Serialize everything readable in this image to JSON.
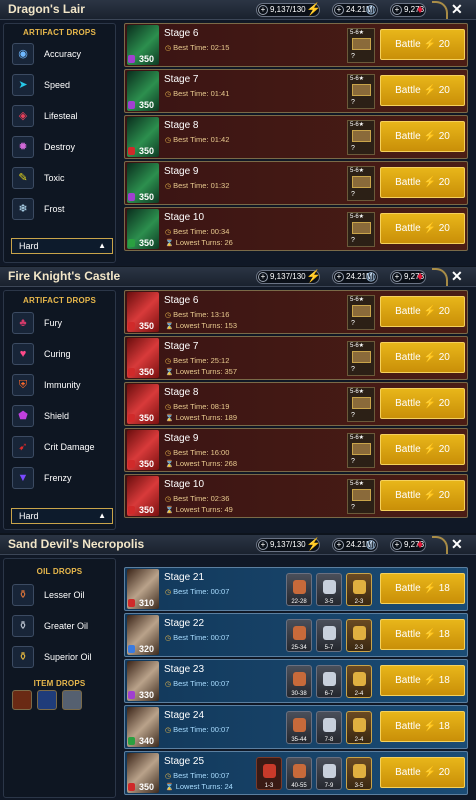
{
  "panels": [
    {
      "title": "Dragon's Lair",
      "resources": {
        "energy": "9,137/130",
        "silver": "24.21M",
        "gems": "9,273"
      },
      "sidebar_heading": "ARTIFACT DROPS",
      "sidebar_items": [
        {
          "label": "Accuracy",
          "icon": "accuracy-icon",
          "glyph": "◉",
          "color": "#6fb8ff"
        },
        {
          "label": "Speed",
          "icon": "speed-icon",
          "glyph": "➤",
          "color": "#27c8e8"
        },
        {
          "label": "Lifesteal",
          "icon": "lifesteal-icon",
          "glyph": "◈",
          "color": "#e8405a"
        },
        {
          "label": "Destroy",
          "icon": "destroy-icon",
          "glyph": "✹",
          "color": "#d06ad8"
        },
        {
          "label": "Toxic",
          "icon": "toxic-icon",
          "glyph": "✎",
          "color": "#e6d81c"
        },
        {
          "label": "Frost",
          "icon": "frost-icon",
          "glyph": "❄",
          "color": "#bfe8ff"
        }
      ],
      "difficulty": "Hard",
      "stages": [
        {
          "stage": "Stage 6",
          "best": "Best Time: 02:15",
          "turns": "",
          "level": "350",
          "reward": "5-6★",
          "reward_q": "?",
          "battle": "Battle",
          "cost": "20"
        },
        {
          "stage": "Stage 7",
          "best": "Best Time: 01:41",
          "turns": "",
          "level": "350",
          "reward": "5-6★",
          "reward_q": "?",
          "battle": "Battle",
          "cost": "20"
        },
        {
          "stage": "Stage 8",
          "best": "Best Time: 01:42",
          "turns": "",
          "level": "350",
          "reward": "5-6★",
          "reward_q": "?",
          "battle": "Battle",
          "cost": "20"
        },
        {
          "stage": "Stage 9",
          "best": "Best Time: 01:32",
          "turns": "",
          "level": "350",
          "reward": "5-6★",
          "reward_q": "?",
          "battle": "Battle",
          "cost": "20"
        },
        {
          "stage": "Stage 10",
          "best": "Best Time: 00:34",
          "turns": "Lowest Turns: 26",
          "level": "350",
          "reward": "5-6★",
          "reward_q": "?",
          "battle": "Battle",
          "cost": "20"
        }
      ]
    },
    {
      "title": "Fire Knight's Castle",
      "resources": {
        "energy": "9,137/130",
        "silver": "24.21M",
        "gems": "9,273"
      },
      "sidebar_heading": "ARTIFACT DROPS",
      "sidebar_items": [
        {
          "label": "Fury",
          "icon": "fury-icon",
          "glyph": "♣",
          "color": "#d23a6a"
        },
        {
          "label": "Curing",
          "icon": "curing-icon",
          "glyph": "♥",
          "color": "#ff4a8a"
        },
        {
          "label": "Immunity",
          "icon": "immunity-icon",
          "glyph": "⛨",
          "color": "#ff6a2a"
        },
        {
          "label": "Shield",
          "icon": "shield-icon",
          "glyph": "⬟",
          "color": "#c040e0"
        },
        {
          "label": "Crit Damage",
          "icon": "crit-damage-icon",
          "glyph": "➹",
          "color": "#e02a2a"
        },
        {
          "label": "Frenzy",
          "icon": "frenzy-icon",
          "glyph": "▼",
          "color": "#7a4aff"
        }
      ],
      "difficulty": "Hard",
      "stages": [
        {
          "stage": "Stage 6",
          "best": "Best Time: 13:16",
          "turns": "Lowest Turns: 153",
          "level": "350",
          "reward": "5-6★",
          "reward_q": "?",
          "battle": "Battle",
          "cost": "20"
        },
        {
          "stage": "Stage 7",
          "best": "Best Time: 25:12",
          "turns": "Lowest Turns: 357",
          "level": "350",
          "reward": "5-6★",
          "reward_q": "?",
          "battle": "Battle",
          "cost": "20"
        },
        {
          "stage": "Stage 8",
          "best": "Best Time: 08:19",
          "turns": "Lowest Turns: 189",
          "level": "350",
          "reward": "5-6★",
          "reward_q": "?",
          "battle": "Battle",
          "cost": "20"
        },
        {
          "stage": "Stage 9",
          "best": "Best Time: 16:00",
          "turns": "Lowest Turns: 268",
          "level": "350",
          "reward": "5-6★",
          "reward_q": "?",
          "battle": "Battle",
          "cost": "20"
        },
        {
          "stage": "Stage 10",
          "best": "Best Time: 02:36",
          "turns": "Lowest Turns: 49",
          "level": "350",
          "reward": "5-6★",
          "reward_q": "?",
          "battle": "Battle",
          "cost": "20"
        }
      ]
    },
    {
      "title": "Sand Devil's Necropolis",
      "resources": {
        "energy": "9,137/130",
        "silver": "24.21M",
        "gems": "9,273"
      },
      "sidebar_heading": "OIL DROPS",
      "sidebar_items": [
        {
          "label": "Lesser Oil",
          "icon": "lesser-oil-icon",
          "glyph": "⚱",
          "color": "#e87a3a"
        },
        {
          "label": "Greater Oil",
          "icon": "greater-oil-icon",
          "glyph": "⚱",
          "color": "#c8d0dc"
        },
        {
          "label": "Superior Oil",
          "icon": "superior-oil-icon",
          "glyph": "⚱",
          "color": "#f0c040"
        }
      ],
      "item_heading": "ITEM DROPS",
      "stages": [
        {
          "stage": "Stage 21",
          "best": "Best Time: 00:07",
          "turns": "",
          "level": "310",
          "battle": "Battle",
          "cost": "18",
          "oils": [
            "22-28",
            "3-5",
            "2-3"
          ]
        },
        {
          "stage": "Stage 22",
          "best": "Best Time: 00:07",
          "turns": "",
          "level": "320",
          "battle": "Battle",
          "cost": "18",
          "oils": [
            "25-34",
            "5-7",
            "2-3"
          ]
        },
        {
          "stage": "Stage 23",
          "best": "Best Time: 00:07",
          "turns": "",
          "level": "330",
          "battle": "Battle",
          "cost": "18",
          "oils": [
            "30-38",
            "6-7",
            "2-4"
          ]
        },
        {
          "stage": "Stage 24",
          "best": "Best Time: 00:07",
          "turns": "",
          "level": "340",
          "battle": "Battle",
          "cost": "18",
          "oils": [
            "35-44",
            "7-8",
            "2-4"
          ]
        },
        {
          "stage": "Stage 25",
          "best": "Best Time: 00:07",
          "turns": "Lowest Turns: 24",
          "level": "350",
          "battle": "Battle",
          "cost": "20",
          "oils": [
            "1-3",
            "40-55",
            "7-9",
            "3-5"
          ]
        }
      ]
    }
  ]
}
